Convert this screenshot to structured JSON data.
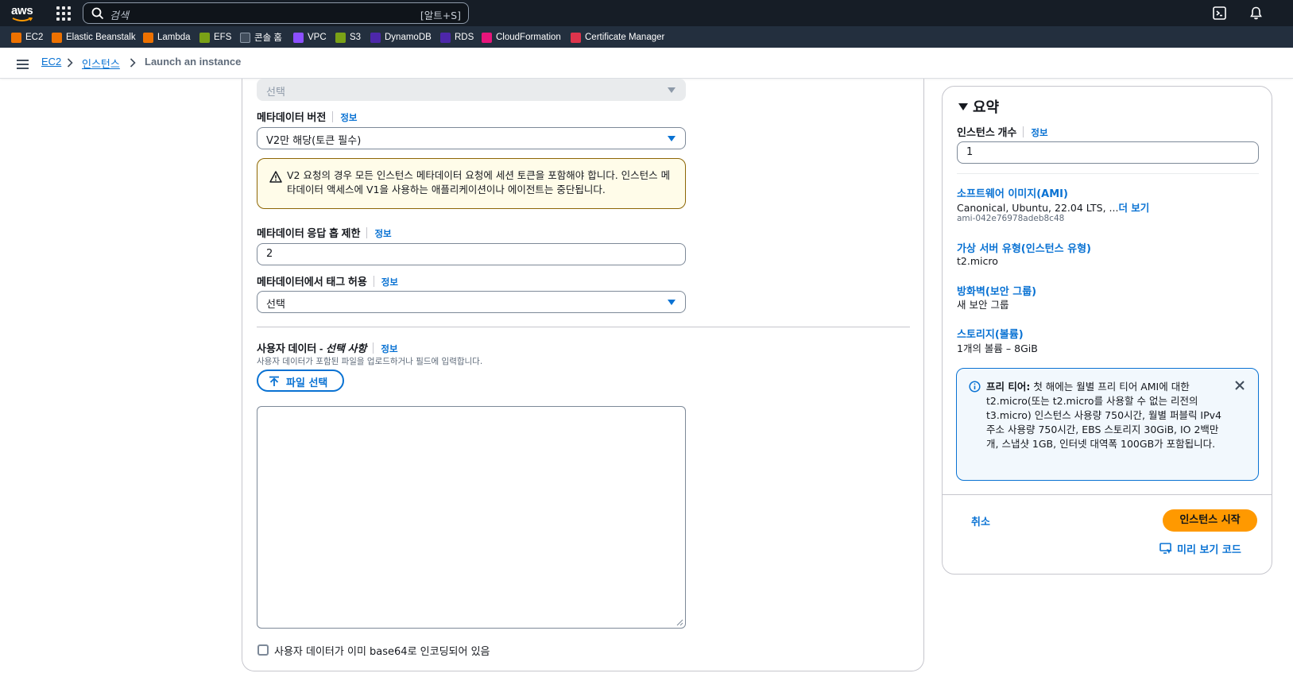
{
  "topbar": {
    "logo": "aws",
    "search_placeholder": "검색",
    "search_shortcut": "[알트+S]"
  },
  "favorites": [
    {
      "label": "EC2",
      "icon": "ec2-icon",
      "color": "#ed7100"
    },
    {
      "label": "Elastic Beanstalk",
      "icon": "elastic-beanstalk-icon",
      "color": "#ed7100"
    },
    {
      "label": "Lambda",
      "icon": "lambda-icon",
      "color": "#ed7100"
    },
    {
      "label": "EFS",
      "icon": "efs-icon",
      "color": "#7aa116"
    },
    {
      "label": "콘솔 홈",
      "icon": "console-home-icon",
      "color": "#414d5c"
    },
    {
      "label": "VPC",
      "icon": "vpc-icon",
      "color": "#8c4fff"
    },
    {
      "label": "S3",
      "icon": "s3-icon",
      "color": "#7aa116"
    },
    {
      "label": "DynamoDB",
      "icon": "dynamodb-icon",
      "color": "#4d27aa"
    },
    {
      "label": "RDS",
      "icon": "rds-icon",
      "color": "#4d27aa"
    },
    {
      "label": "CloudFormation",
      "icon": "cloudformation-icon",
      "color": "#e7157b"
    },
    {
      "label": "Certificate Manager",
      "icon": "certificate-manager-icon",
      "color": "#dd344c"
    }
  ],
  "breadcrumb": {
    "items": [
      "EC2",
      "인스턴스"
    ],
    "current": "Launch an instance"
  },
  "form": {
    "top_select_value": "선택",
    "metadata_version": {
      "label": "메타데이터 버전",
      "info": "정보",
      "value": "V2만 해당(토큰 필수)"
    },
    "warning_text": "V2 요청의 경우 모든 인스턴스 메타데이터 요청에 세션 토큰을 포함해야 합니다. 인스턴스 메타데이터 액세스에 V1을 사용하는 애플리케이션이나 에이전트는 중단됩니다.",
    "hop_limit": {
      "label": "메타데이터 응답 홉 제한",
      "info": "정보",
      "value": "2"
    },
    "tags_in_metadata": {
      "label": "메타데이터에서 태그 허용",
      "info": "정보",
      "value": "선택"
    },
    "user_data": {
      "label": "사용자 데이터 - ",
      "label_optional": "선택 사항",
      "info": "정보",
      "description": "사용자 데이터가 포함된 파일을 업로드하거나 필드에 입력합니다.",
      "file_button": "파일 선택",
      "value": "",
      "base64_checkbox_label": "사용자 데이터가 이미 base64로 인코딩되어 있음",
      "base64_checked": false
    }
  },
  "summary": {
    "title": "요약",
    "instance_count": {
      "label": "인스턴스 개수",
      "info": "정보",
      "value": "1"
    },
    "ami": {
      "label": "소프트웨어 이미지(AMI)",
      "value": "Canonical, Ubuntu, 22.04 LTS, ...",
      "more": "더 보기",
      "id": "ami-042e76978adeb8c48"
    },
    "instance_type": {
      "label": "가상 서버 유형(인스턴스 유형)",
      "value": "t2.micro"
    },
    "firewall": {
      "label": "방화벽(보안 그룹)",
      "value": "새 보안 그룹"
    },
    "storage": {
      "label": "스토리지(볼륨)",
      "value": "1개의 볼륨 – 8GiB"
    },
    "free_tier": {
      "title": "프리 티어:",
      "text": " 첫 해에는 월별 프리 티어 AMI에 대한 t2.micro(또는 t2.micro를 사용할 수 없는 리전의 t3.micro) 인스턴스 사용량 750시간, 월별 퍼블릭 IPv4 주소 사용량 750시간, EBS 스토리지 30GiB, IO 2백만 개, 스냅샷 1GB, 인터넷 대역폭 100GB가 포함됩니다."
    },
    "cancel": "취소",
    "launch": "인스턴스 시작",
    "preview_code": "미리 보기 코드"
  },
  "colors": {
    "link": "#0972d3",
    "primary_button": "#ff9900",
    "topbar": "#161d26",
    "favbar": "#232f3e",
    "warning_border": "#8d6605",
    "info_bg": "#f2f8fd"
  }
}
